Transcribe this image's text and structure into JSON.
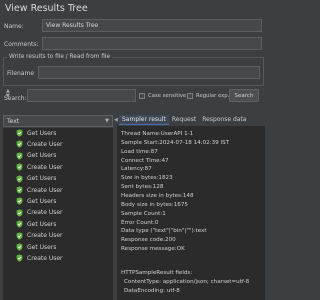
{
  "window": {
    "title": "View Results Tree"
  },
  "name": {
    "label": "Name:",
    "value": "View Results Tree"
  },
  "comments": {
    "label": "Comments:",
    "value": ""
  },
  "file_section": {
    "title": "Write results to file / Read from file",
    "filename_label": "Filename"
  },
  "search": {
    "label": "Search:",
    "value": "",
    "case_sensitive": "Case sensitive",
    "regular_exp": "Regular exp.",
    "button": "Search"
  },
  "renderer": {
    "selected": "Text"
  },
  "tree": {
    "items": [
      {
        "label": "Get Users"
      },
      {
        "label": "Create User"
      },
      {
        "label": "Get Users"
      },
      {
        "label": "Create User"
      },
      {
        "label": "Get Users"
      },
      {
        "label": "Create User"
      },
      {
        "label": "Get Users"
      },
      {
        "label": "Create User"
      },
      {
        "label": "Get Users"
      },
      {
        "label": "Create User"
      },
      {
        "label": "Get Users"
      },
      {
        "label": "Create User"
      }
    ]
  },
  "tabs": [
    {
      "label": "Sampler result",
      "active": true
    },
    {
      "label": "Request",
      "active": false
    },
    {
      "label": "Response data",
      "active": false
    }
  ],
  "sampler_result": [
    "Thread Name:UserAPI 1-1",
    "Sample Start:2024-07-18 14:02:39 IST",
    "Load time:87",
    "Connect Time:47",
    "Latency:87",
    "Size in bytes:1823",
    "Sent bytes:128",
    "Headers size in bytes:148",
    "Body size in bytes:1675",
    "Sample Count:1",
    "Error Count:0",
    "Data type (\"text\"|\"bin\"|\"\"):text",
    "Response code:200",
    "Response message:OK"
  ],
  "http_fields": {
    "title": "HTTPSampleResult fields:",
    "content_type": "ContentType: application/json; charset=utf-8",
    "data_encoding": "DataEncoding: utf-8"
  },
  "colors": {
    "background": "#3c3f41",
    "tree_background": "#2b2b2b",
    "success_icon": "#62b543",
    "accent": "#4b6eaf"
  }
}
